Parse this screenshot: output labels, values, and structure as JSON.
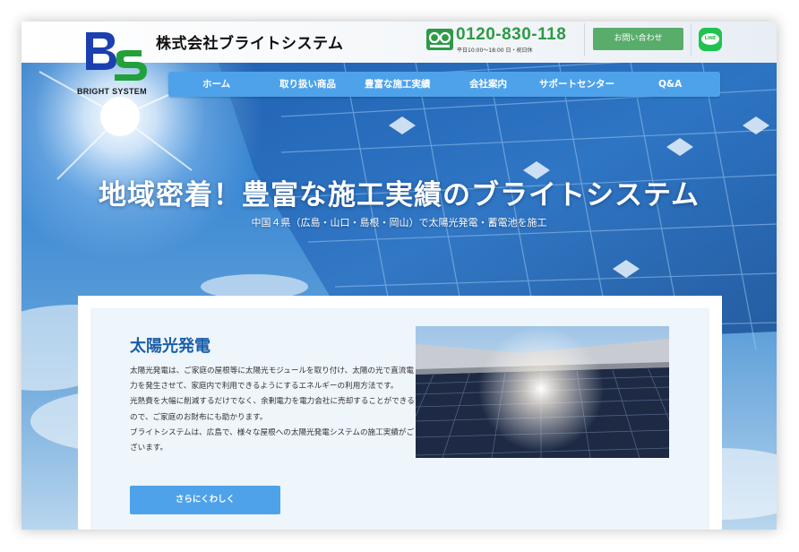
{
  "header": {
    "logo_text": "BRIGHT SYSTEM",
    "company_name": "株式会社ブライトシステム",
    "phone_number": "0120-830-118",
    "phone_hours": "平日10:00〜18:00 日・祝日休",
    "contact_button": "お問い合わせ",
    "line_label": "LINE"
  },
  "nav": {
    "items": [
      "ホーム",
      "取り扱い商品",
      "豊富な施工実績",
      "会社案内",
      "サポートセンター",
      "Q&A"
    ]
  },
  "hero": {
    "title": "地域密着！豊富な施工実績のブライトシステム",
    "subtitle": "中国４県（広島・山口・島根・岡山）で太陽光発電・蓄電池を施工"
  },
  "section": {
    "title": "太陽光発電",
    "paragraphs": [
      "太陽光発電は、ご家庭の屋根等に太陽光モジュールを取り付け、太陽の光で直流電力を発生させて、家庭内で利用できるようにするエネルギーの利用方法です。",
      "光熱費を大幅に削減するだけでなく、余剰電力を電力会社に売却することができるので、ご家庭のお財布にも助かります。",
      "ブライトシステムは、広島で、様々な屋根への太陽光発電システムの施工実績がございます。"
    ],
    "more_button": "さらにくわしく"
  },
  "colors": {
    "accent_blue": "#4ea2ea",
    "phone_green": "#2e9a47",
    "contact_green": "#58ad6b",
    "title_blue": "#1a5fa8"
  }
}
